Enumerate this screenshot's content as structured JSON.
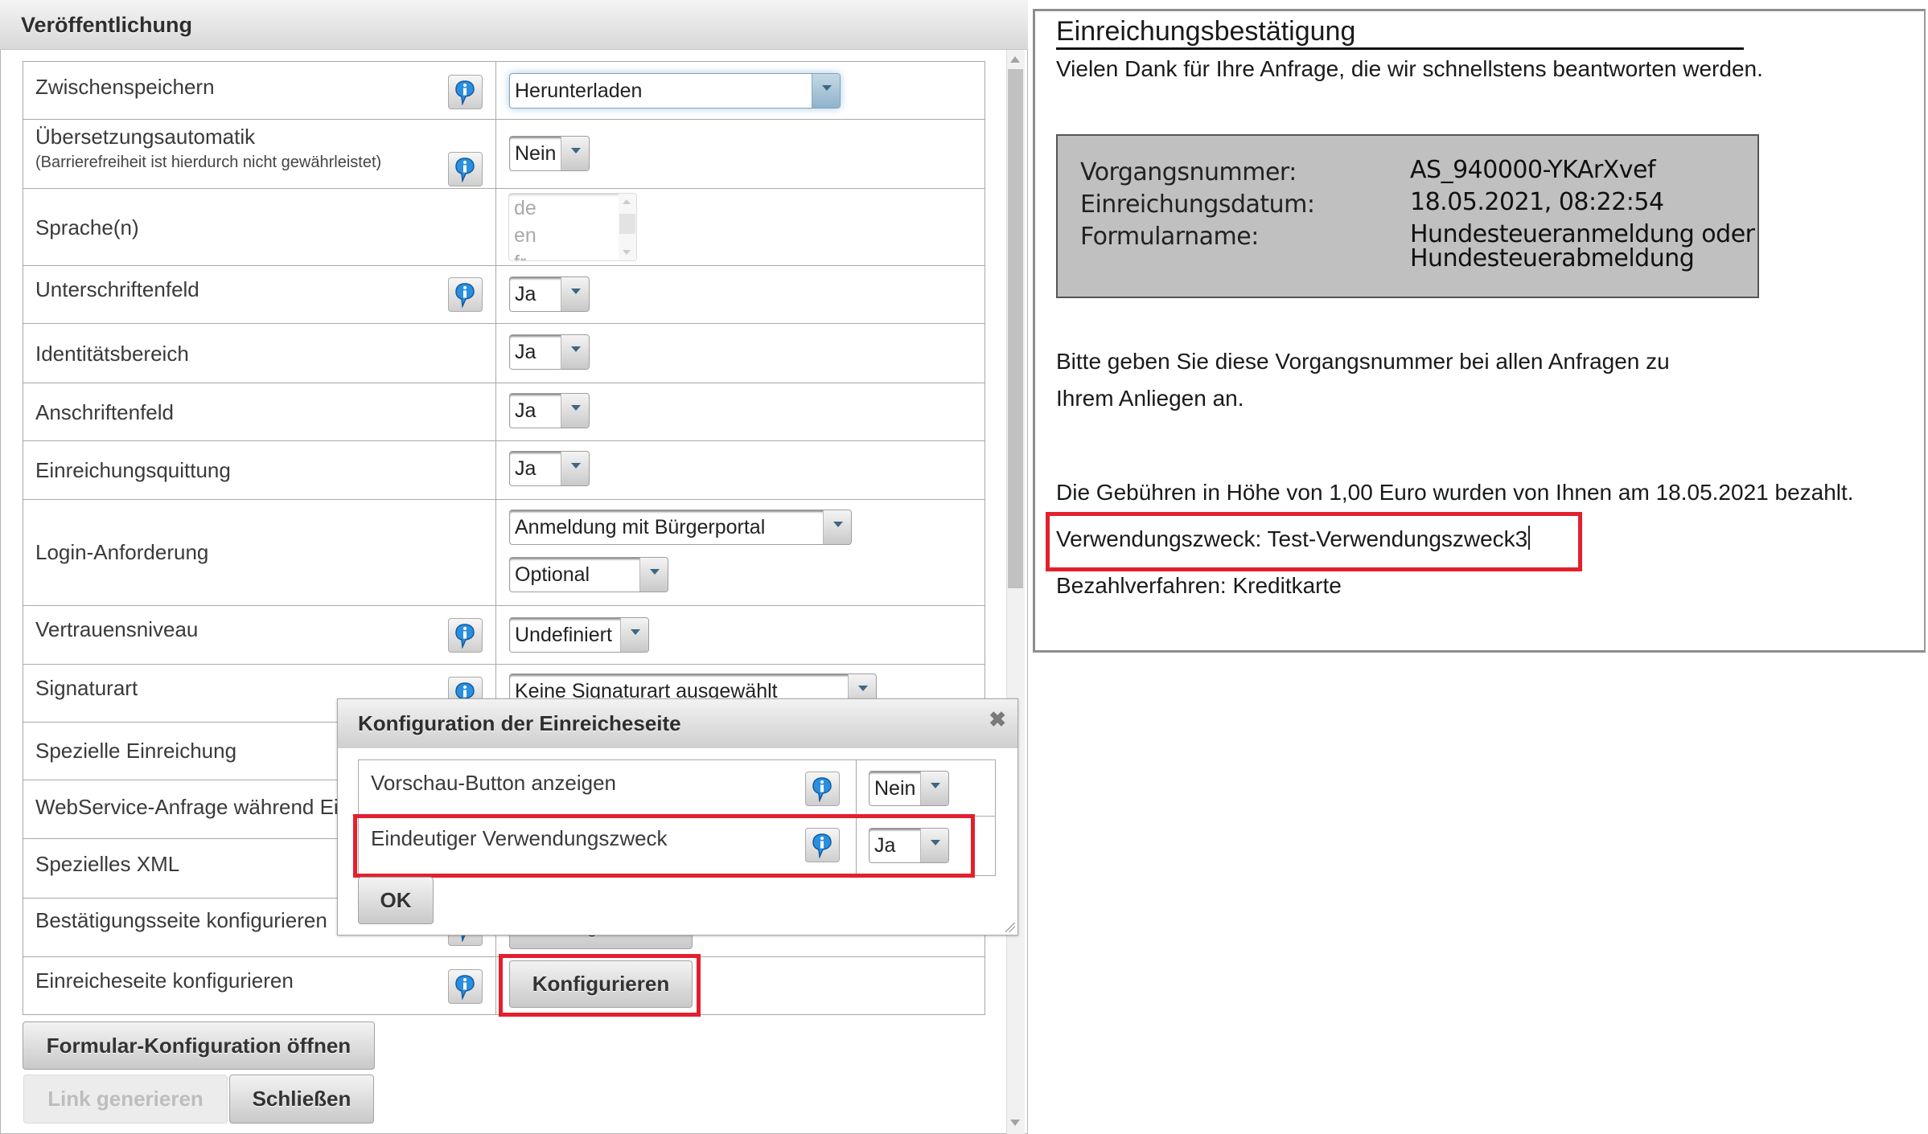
{
  "left_panel": {
    "title": "Veröffentlichung",
    "rows": [
      {
        "label": "Zwischenspeichern",
        "has_info": true,
        "control": "select",
        "value": "Herunterladen"
      },
      {
        "label": "Übersetzungsautomatik",
        "sublabel": "(Barrierefreiheit ist hierdurch nicht gewährleistet)",
        "has_info": true,
        "control": "select",
        "value": "Nein"
      },
      {
        "label": "Sprache(n)",
        "has_info": false,
        "control": "listbox",
        "options": [
          "de",
          "en",
          "fr"
        ]
      },
      {
        "label": "Unterschriftenfeld",
        "has_info": true,
        "control": "select",
        "value": "Ja"
      },
      {
        "label": "Identitätsbereich",
        "has_info": false,
        "control": "select",
        "value": "Ja"
      },
      {
        "label": "Anschriftenfeld",
        "has_info": false,
        "control": "select",
        "value": "Ja"
      },
      {
        "label": "Einreichungsquittung",
        "has_info": false,
        "control": "select",
        "value": "Ja"
      },
      {
        "label": "Login-Anforderung",
        "has_info": false,
        "control": "select2",
        "value": "Anmeldung mit Bürgerportal",
        "value2": "Optional"
      },
      {
        "label": "Vertrauensniveau",
        "has_info": true,
        "control": "select",
        "value": "Undefiniert"
      },
      {
        "label": "Signaturart",
        "has_info": true,
        "control": "select",
        "value": "Keine Signaturart ausgewählt"
      },
      {
        "label": "Spezielle Einreichung",
        "has_info": false
      },
      {
        "label": "WebService-Anfrage während Einreichung",
        "has_info": false
      },
      {
        "label": "Spezielles XML",
        "has_info": false
      },
      {
        "label": "Bestätigungsseite konfigurieren",
        "has_info": true,
        "control": "button",
        "value": "Konfigurieren"
      },
      {
        "label": "Einreicheseite konfigurieren",
        "has_info": true,
        "control": "button",
        "value": "Konfigurieren"
      }
    ],
    "buttons": {
      "open_form_config": "Formular-Konfiguration öffnen",
      "generate_link": "Link generieren",
      "close": "Schließen"
    }
  },
  "dialog": {
    "title": "Konfiguration der Einreicheseite",
    "close_glyph": "✖",
    "rows": [
      {
        "label": "Vorschau-Button anzeigen",
        "value": "Nein"
      },
      {
        "label": "Eindeutiger Verwendungszweck",
        "value": "Ja"
      }
    ],
    "ok_label": "OK"
  },
  "right_panel": {
    "title": "Einreichungsbestätigung",
    "thanks": "Vielen Dank für Ihre Anfrage, die wir schnellstens beantworten werden.",
    "info": [
      {
        "label": "Vorgangsnummer:",
        "value": "AS_940000-YKArXvef"
      },
      {
        "label": "Einreichungsdatum:",
        "value": "18.05.2021, 08:22:54"
      },
      {
        "label": "Formularname:",
        "value": "Hundesteueranmeldung oder",
        "value2": "Hundesteuerabmeldung"
      }
    ],
    "note_line1": "Bitte geben Sie diese Vorgangsnummer bei allen Anfragen zu",
    "note_line2": "Ihrem Anliegen an.",
    "fees": "Die Gebühren in Höhe von 1,00 Euro wurden von Ihnen am 18.05.2021 bezahlt.",
    "purpose": "Verwendungszweck: Test-Verwendungszweck3",
    "payment": "Bezahlverfahren: Kreditkarte"
  },
  "colors": {
    "highlight": "#e3202e",
    "select_arrow": "#3d6781",
    "info_icon": "#1e7fd0"
  },
  "icons": {
    "info": "info-speech-bubble-icon",
    "close": "close-x-icon",
    "dropdown": "chevron-down-icon"
  }
}
